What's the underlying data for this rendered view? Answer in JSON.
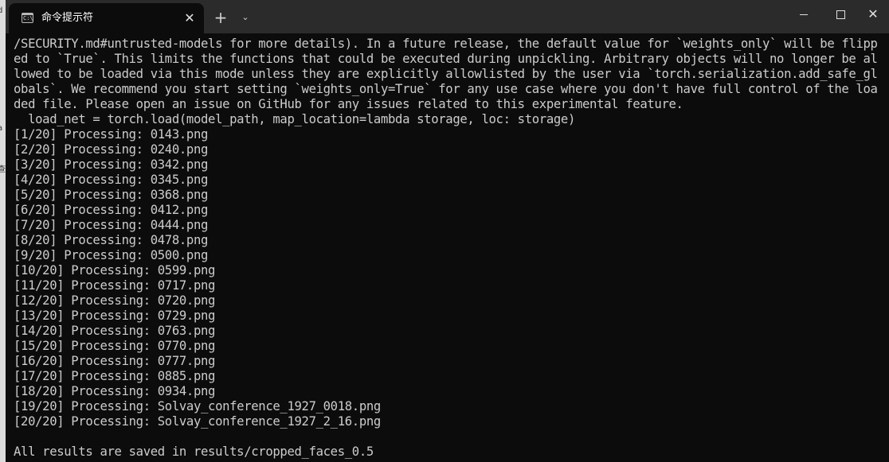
{
  "window": {
    "tab_title": "命令提示符",
    "tab_icon": "cmd-icon",
    "tab_icon_text": "C:\\",
    "close_tab_symbol": "✕",
    "new_tab_symbol": "+",
    "dropdown_symbol": "⌄",
    "minimize_icon": "minimize-icon",
    "maximize_icon": "maximize-icon",
    "close_symbol": "✕"
  },
  "background_window": {
    "fragments": [
      "d",
      "查",
      "a"
    ]
  },
  "console": {
    "lines": [
      "/SECURITY.md#untrusted-models for more details). In a future release, the default value for `weights_only` will be flipp",
      "ed to `True`. This limits the functions that could be executed during unpickling. Arbitrary objects will no longer be al",
      "lowed to be loaded via this mode unless they are explicitly allowlisted by the user via `torch.serialization.add_safe_gl",
      "obals`. We recommend you start setting `weights_only=True` for any use case where you don't have full control of the loa",
      "ded file. Please open an issue on GitHub for any issues related to this experimental feature.",
      "  load_net = torch.load(model_path, map_location=lambda storage, loc: storage)",
      "[1/20] Processing: 0143.png",
      "[2/20] Processing: 0240.png",
      "[3/20] Processing: 0342.png",
      "[4/20] Processing: 0345.png",
      "[5/20] Processing: 0368.png",
      "[6/20] Processing: 0412.png",
      "[7/20] Processing: 0444.png",
      "[8/20] Processing: 0478.png",
      "[9/20] Processing: 0500.png",
      "[10/20] Processing: 0599.png",
      "[11/20] Processing: 0717.png",
      "[12/20] Processing: 0720.png",
      "[13/20] Processing: 0729.png",
      "[14/20] Processing: 0763.png",
      "[15/20] Processing: 0770.png",
      "[16/20] Processing: 0777.png",
      "[17/20] Processing: 0885.png",
      "[18/20] Processing: 0934.png",
      "[19/20] Processing: Solvay_conference_1927_0018.png",
      "[20/20] Processing: Solvay_conference_1927_2_16.png",
      "",
      "All results are saved in results/cropped_faces_0.5"
    ]
  },
  "colors": {
    "console_bg": "#0c0c0c",
    "titlebar_bg": "#2b2b2b",
    "text": "#cccccc"
  }
}
